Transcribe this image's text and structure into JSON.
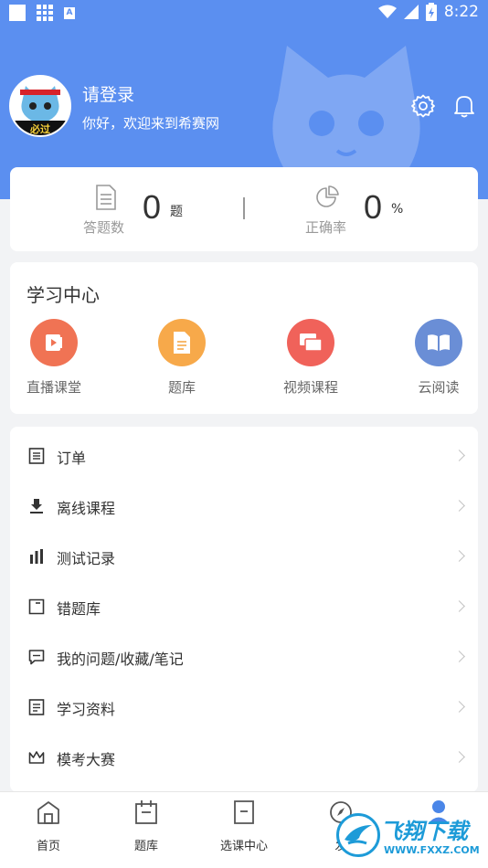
{
  "status_bar": {
    "time": "8:22"
  },
  "header": {
    "title": "请登录",
    "welcome": "你好，欢迎来到希赛网",
    "avatar_badge": "必过",
    "bg_color": "#5b8ff0"
  },
  "stats": {
    "answered": {
      "label": "答题数",
      "value": "0",
      "unit": "题"
    },
    "accuracy": {
      "label": "正确率",
      "value": "0",
      "unit": "%"
    }
  },
  "study_center": {
    "title": "学习中心",
    "items": [
      {
        "label": "直播课堂",
        "icon": "play-video-icon",
        "color": "#f07354"
      },
      {
        "label": "题库",
        "icon": "document-icon",
        "color": "#f7a94a"
      },
      {
        "label": "视频课程",
        "icon": "screens-icon",
        "color": "#f0625a"
      },
      {
        "label": "云阅读",
        "icon": "open-book-icon",
        "color": "#6a8ed6"
      }
    ]
  },
  "menu": {
    "items": [
      {
        "label": "订单",
        "icon": "order-icon"
      },
      {
        "label": "离线课程",
        "icon": "download-icon"
      },
      {
        "label": "测试记录",
        "icon": "bar-chart-icon"
      },
      {
        "label": "错题库",
        "icon": "wrong-question-icon"
      },
      {
        "label": "我的问题/收藏/笔记",
        "icon": "chat-icon"
      },
      {
        "label": "学习资料",
        "icon": "list-doc-icon"
      },
      {
        "label": "模考大赛",
        "icon": "crown-icon"
      }
    ]
  },
  "bottom_nav": {
    "items": [
      {
        "label": "首页",
        "icon": "home-icon"
      },
      {
        "label": "题库",
        "icon": "calendar-icon"
      },
      {
        "label": "选课中心",
        "icon": "course-doc-icon"
      },
      {
        "label": "发",
        "icon": "compass-icon"
      },
      {
        "label": "",
        "icon": "user-icon"
      }
    ]
  },
  "watermark": {
    "title": "飞翔下载",
    "url": "WWW.FXXZ.COM"
  }
}
